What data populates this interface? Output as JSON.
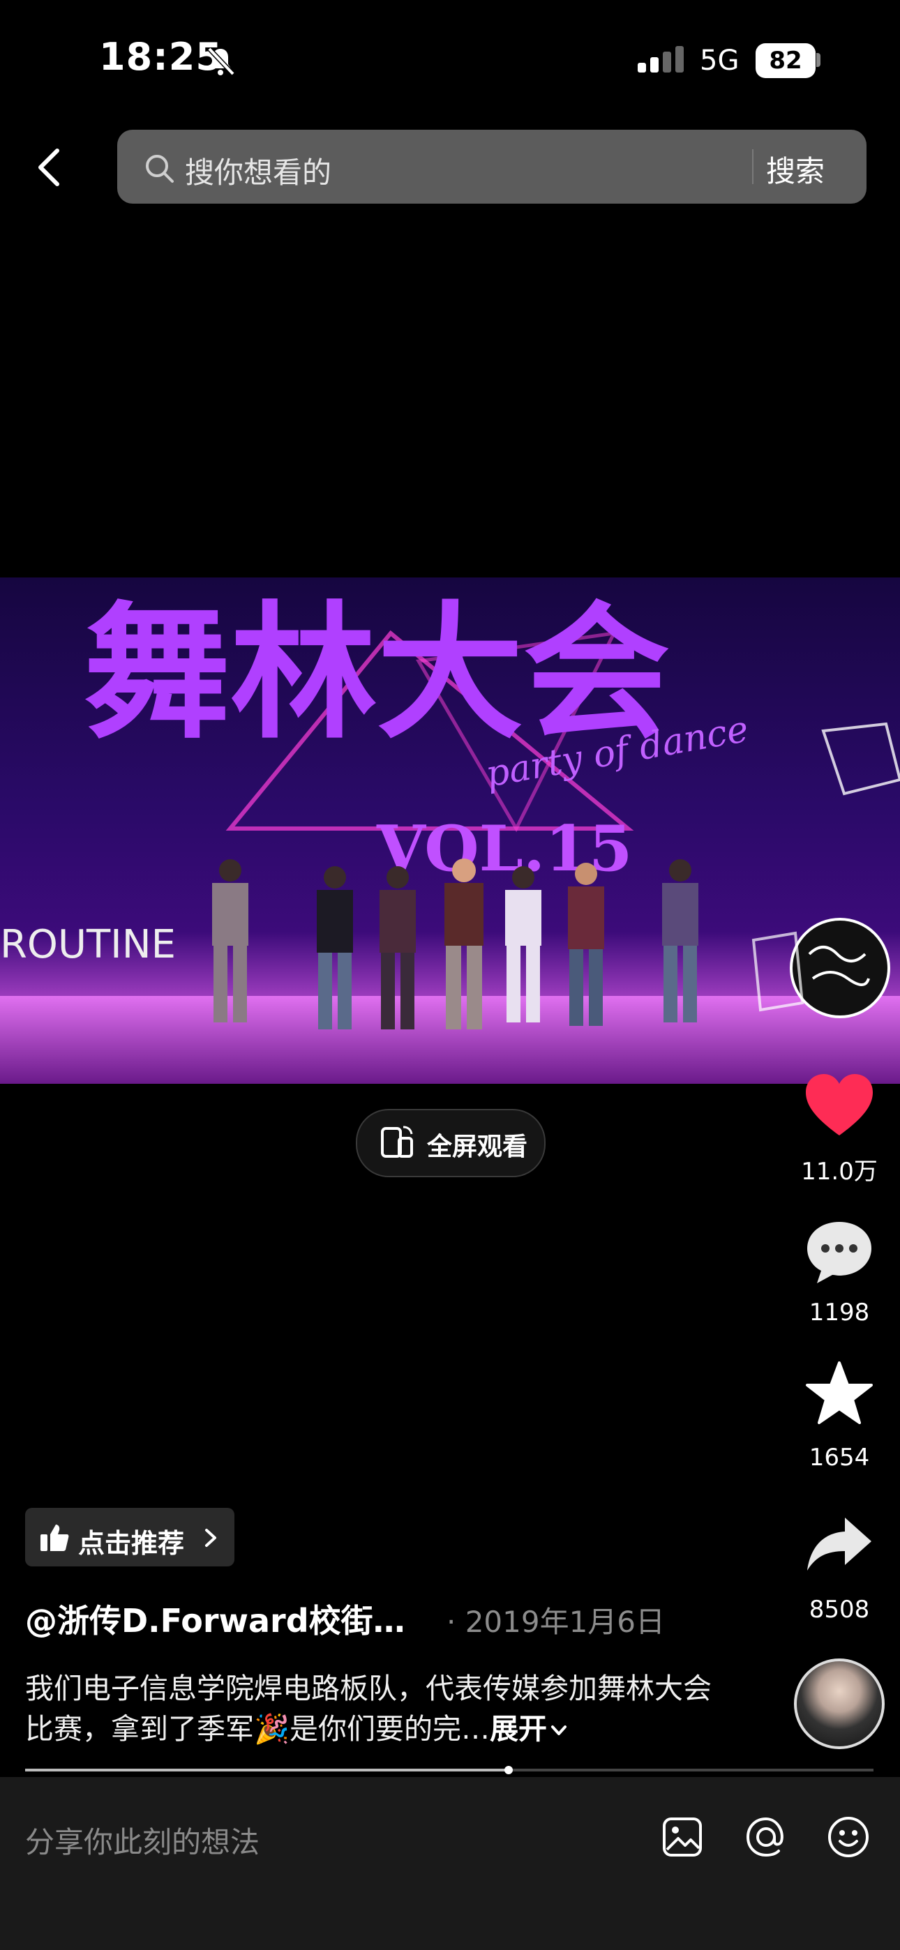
{
  "status_bar": {
    "time": "18:25",
    "network": "5G",
    "battery": "82"
  },
  "search": {
    "placeholder": "搜你想看的",
    "button_label": "搜索"
  },
  "player": {
    "fullscreen_label": "全屏观看",
    "progress": 0.57
  },
  "video_overlay": {
    "title_art": "舞林大会",
    "subtitle_art": "party of dance",
    "vol": "VOL.15",
    "left_banner": "ROUTINE"
  },
  "actions": {
    "likes": "11.0万",
    "comments": "1198",
    "favorites": "1654",
    "shares": "8508",
    "like_color": "#fe2c55"
  },
  "post": {
    "recommend_label": "点击推荐",
    "author": "@浙传D.Forward校街…",
    "date": "· 2019年1月6日",
    "caption": "我们电子信息学院焊电路板队，代表传媒参加舞林大会比赛，拿到了季军🎉是你们要的完…",
    "expand_label": "展开"
  },
  "comment_bar": {
    "placeholder": "分享你此刻的想法"
  }
}
